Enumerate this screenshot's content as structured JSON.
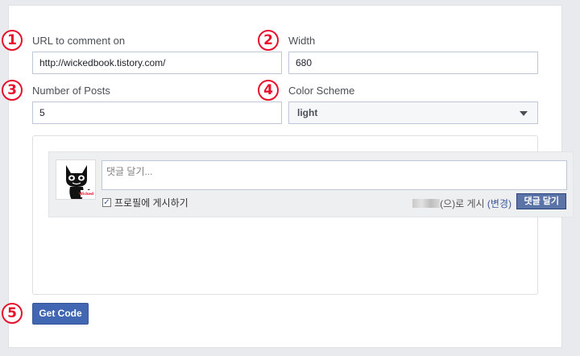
{
  "form": {
    "url": {
      "marker": "1",
      "label": "URL to comment on",
      "value": "http://wickedbook.tistory.com/"
    },
    "width": {
      "marker": "2",
      "label": "Width",
      "value": "680"
    },
    "posts": {
      "marker": "3",
      "label": "Number of Posts",
      "value": "5"
    },
    "color_scheme": {
      "marker": "4",
      "label": "Color Scheme",
      "selected": "light"
    }
  },
  "preview": {
    "comment_placeholder": "댓글 달기...",
    "post_to_profile_label": "프로필에 게시하기",
    "post_to_profile_checked": true,
    "posting_as_suffix": "(으)로 게시",
    "change_link": "(변경)",
    "post_button": "댓글 달기",
    "avatar_caption": "Wicked"
  },
  "actions": {
    "marker": "5",
    "get_code_label": "Get Code"
  },
  "colors": {
    "accent_marker": "#e8102a",
    "button_blue": "#4267b2",
    "post_button_blue": "#5b74a8"
  }
}
